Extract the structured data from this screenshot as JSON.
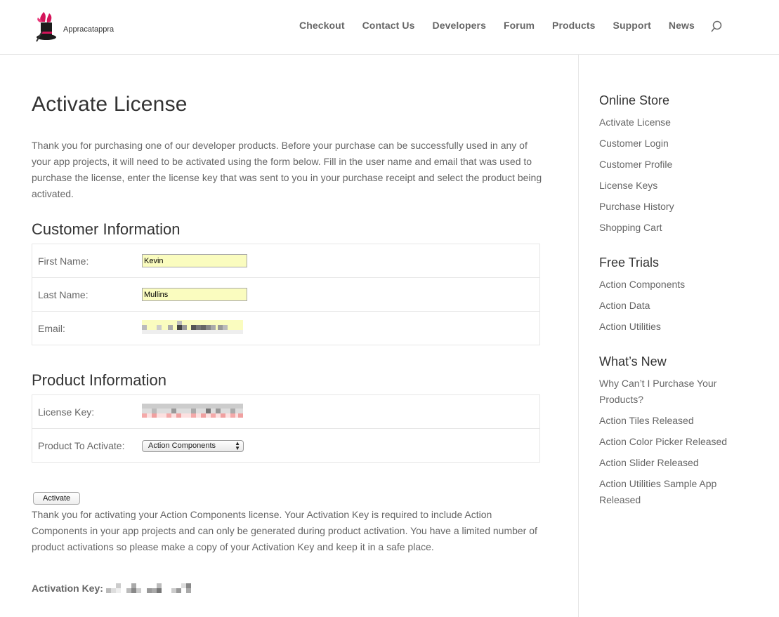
{
  "header": {
    "logo_text": "Appracatappra",
    "nav": [
      "Checkout",
      "Contact Us",
      "Developers",
      "Forum",
      "Products",
      "Support",
      "News"
    ]
  },
  "page": {
    "title": "Activate License",
    "intro": "Thank you for purchasing one of our developer products. Before your purchase can be successfully used in any of your app projects, it will need to be activated using the form below. Fill in the user name and email that was used to purchase the license, enter the license key that was sent to you in your purchase receipt and select the product being activated."
  },
  "customer": {
    "title": "Customer Information",
    "first_name_label": "First Name:",
    "first_name_value": "Kevin",
    "last_name_label": "Last Name:",
    "last_name_value": "Mullins",
    "email_label": "Email:"
  },
  "product": {
    "title": "Product Information",
    "license_key_label": "License Key:",
    "product_label": "Product To Activate:",
    "product_selected": "Action Components"
  },
  "activate": {
    "button_label": "Activate",
    "message": "Thank you for activating your Action Components license. Your Activation Key is required to include Action Components in your app projects and can only be generated during product activation. You have a limited number of product activations so please make a copy of your Activation Key and keep it in a safe place.",
    "key_label": "Activation Key:"
  },
  "sidebar": {
    "online_store": {
      "title": "Online Store",
      "items": [
        "Activate License",
        "Customer Login",
        "Customer Profile",
        "License Keys",
        "Purchase History",
        "Shopping Cart"
      ]
    },
    "free_trials": {
      "title": "Free Trials",
      "items": [
        "Action Components",
        "Action Data",
        "Action Utilities"
      ]
    },
    "whats_new": {
      "title": "What’s New",
      "items": [
        "Why Can’t I Purchase Your Products?",
        "Action Tiles Released",
        "Action Color Picker Released",
        "Action Slider Released",
        "Action Utilities Sample App Released"
      ]
    }
  },
  "colors": {
    "text": "#666666",
    "heading": "#333333",
    "input_fill": "#fafcbf",
    "logo_accent": "#d4145a"
  }
}
